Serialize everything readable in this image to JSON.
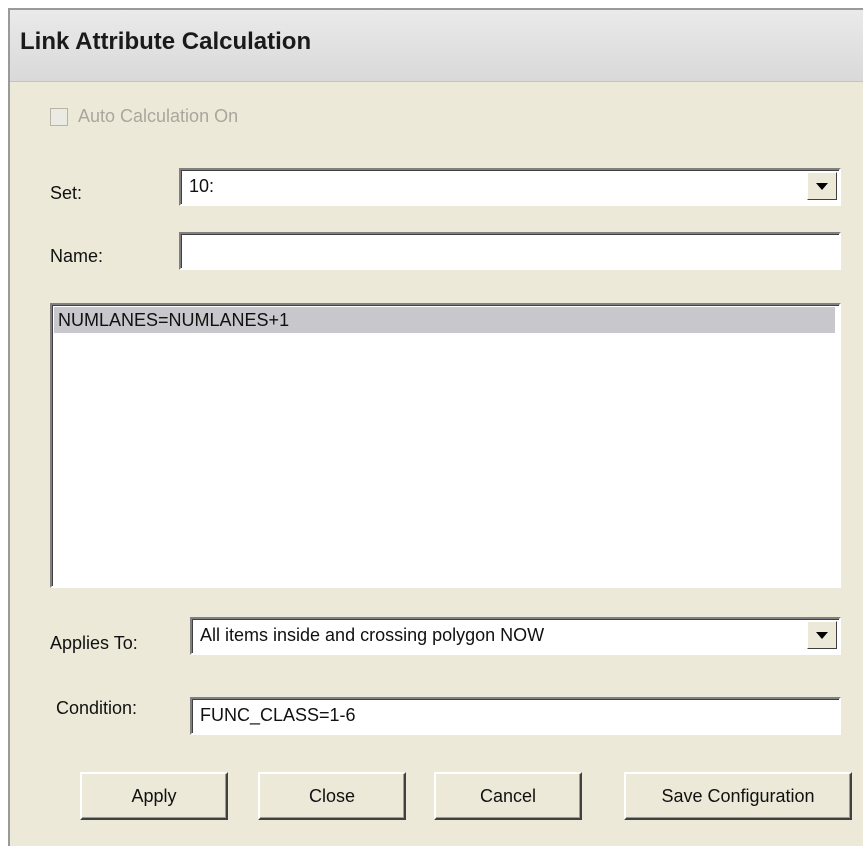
{
  "window": {
    "title": "Link Attribute Calculation"
  },
  "auto_calc": {
    "label": "Auto Calculation On",
    "checked": false,
    "enabled": false
  },
  "set": {
    "label": "Set:",
    "value": "10:"
  },
  "name": {
    "label": "Name:",
    "value": ""
  },
  "expressions": {
    "items": [
      "NUMLANES=NUMLANES+1"
    ],
    "selected_index": 0
  },
  "applies_to": {
    "label": "Applies To:",
    "value": "All items inside and crossing polygon NOW"
  },
  "condition": {
    "label": "Condition:",
    "value": "FUNC_CLASS=1-6"
  },
  "buttons": {
    "apply": "Apply",
    "close": "Close",
    "cancel": "Cancel",
    "save": "Save Configuration"
  },
  "icons": {
    "dropdown": "chevron-down-icon"
  },
  "colors": {
    "dialog_bg": "#ece9d8",
    "selection_bg": "#c8c8cc",
    "disabled_text": "#a9a79c"
  }
}
